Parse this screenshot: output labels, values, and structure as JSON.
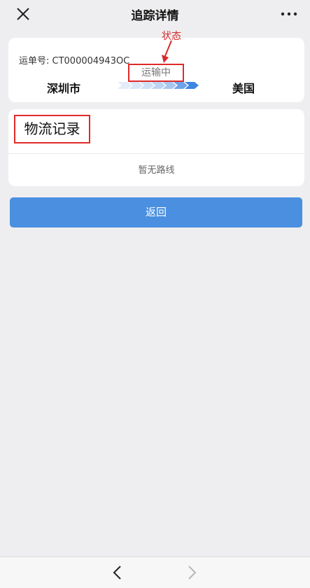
{
  "header": {
    "title": "追踪详情",
    "close_icon": "close-icon",
    "more_icon": "more-icon"
  },
  "shipment": {
    "waybill_label": "运单号: CT000004943OC",
    "origin": "深圳市",
    "destination": "美国",
    "status": "运输中",
    "annotation": "状态",
    "annotation_color": "#d62b2b",
    "progress_icon": "progress-arrows-icon"
  },
  "records": {
    "title": "物流记录",
    "empty_text": "暂无路线"
  },
  "actions": {
    "back_label": "返回",
    "back_color": "#4a8fe0"
  },
  "bottom_nav": {
    "back_icon": "chevron-left-icon",
    "forward_icon": "chevron-right-icon"
  }
}
